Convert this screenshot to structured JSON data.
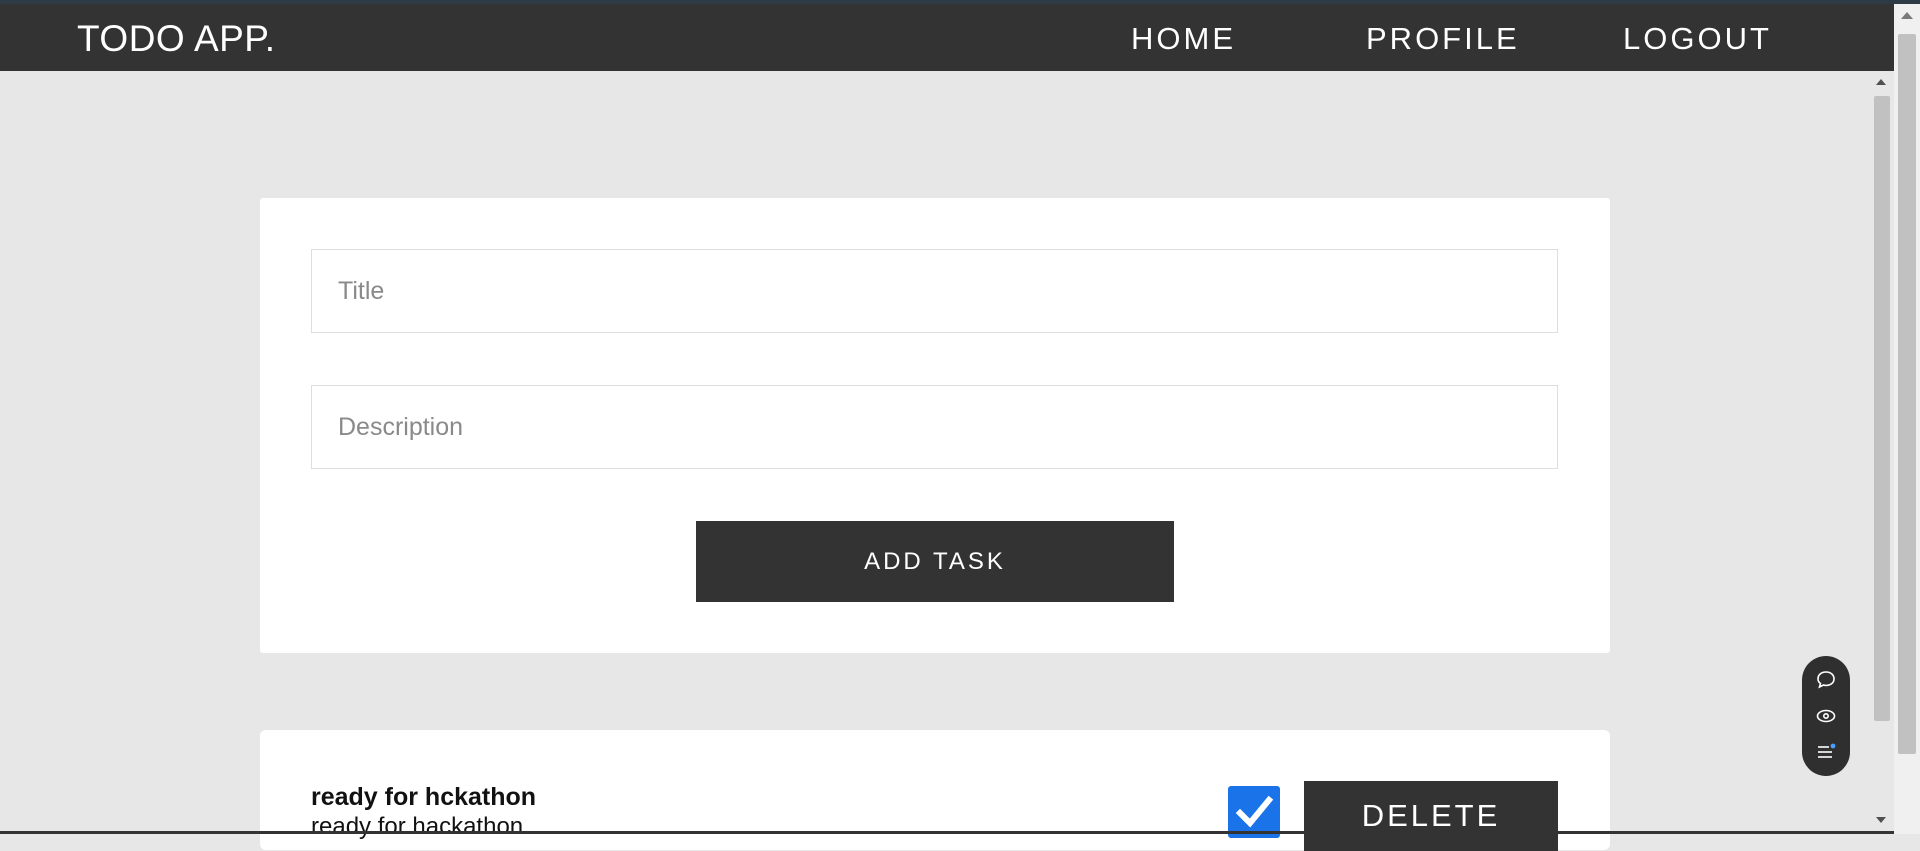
{
  "app": {
    "brand": "TODO APP."
  },
  "nav": {
    "home": "HOME",
    "profile": "PROFILE",
    "logout": "LOGOUT"
  },
  "form": {
    "title_placeholder": "Title",
    "title_value": "",
    "description_placeholder": "Description",
    "description_value": "",
    "add_button": "ADD TASK"
  },
  "tasks": [
    {
      "title": "ready for hckathon",
      "description": "ready for hackathon",
      "completed": true,
      "delete_label": "DELETE"
    }
  ],
  "floating_toolbar": {
    "icons": [
      "chat-bubble-icon",
      "eye-icon",
      "list-notification-icon"
    ]
  },
  "colors": {
    "navbar": "#333333",
    "page_background": "#e7e7e7",
    "card": "#ffffff",
    "button": "#333333",
    "checkbox_accent": "#1a73e8"
  }
}
